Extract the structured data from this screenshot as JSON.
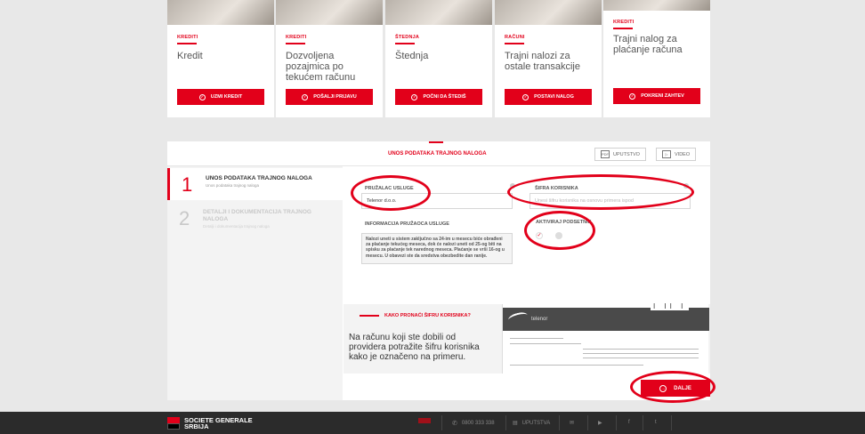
{
  "colors": {
    "accent": "#e2001a",
    "footer": "#2b2b2b"
  },
  "cards": [
    {
      "category": "KREDITI",
      "title": "Kredit",
      "button": "UZMI KREDIT"
    },
    {
      "category": "KREDITI",
      "title": "Dozvoljena pozajmica po tekućem računu",
      "button": "POŠALJI PRIJAVU"
    },
    {
      "category": "ŠTEDNJA",
      "title": "Štednja",
      "button": "POČNI DA ŠTEDIŠ"
    },
    {
      "category": "RAČUNI",
      "title": "Trajni nalozi za ostale transakcije",
      "button": "POSTAVI NALOG"
    },
    {
      "category": "KREDITI",
      "title": "Trajni nalog za plaćanje računa",
      "button": "POKRENI ZAHTEV"
    }
  ],
  "form": {
    "title": "UNOS PODATAKA TRAJNOG NALOGA",
    "manual_label": "UPUTSTVO",
    "video_label": "VIDEO",
    "steps": [
      {
        "num": "1",
        "title": "UNOS PODATAKA TRAJNOG NALOGA",
        "subtitle": "Unos podataka trajnog naloga"
      },
      {
        "num": "2",
        "title": "DETALJI I DOKUMENTACIJA TRAJNOG NALOGA",
        "subtitle": "Detalji i dokumentacija trajnog naloga"
      }
    ],
    "provider_label": "PRUŽALAC USLUGE",
    "provider_value": "Telenor d.o.o.",
    "user_code_label": "ŠIFRA KORISNIKA",
    "user_code_placeholder": "Unesi šifru korisnika na osnovu primera ispod",
    "info_label": "INFORMACIJA PRUŽAOCA USLUGE",
    "info_text": "Nalozi uneti u sistem zaključno sa 24-im u mesecu biće obrađeni za plaćanje tekućeg meseca, dok će nalozi uneti od 25-og biti na spisku za plaćanje tek narednog meseca. Plaćanje se vrši 16-og u mesecu. U obavezi ste da sredstva obezbedite dan ranije.",
    "reminder_label": "AKTIVIRAJ PODSETNIK",
    "help_title": "KAKO PRONAĆI ŠIFRU KORISNIKA?",
    "help_text": "Na računu koji ste dobili od providera potražite šifru korisnika kako je označeno na primeru.",
    "bill_brand": "telenor",
    "bill_ticks": "I II I",
    "next_button": "DALJE"
  },
  "footer": {
    "brand_line1": "SOCIETE GENERALE",
    "brand_line2": "SRBIJA",
    "phone": "0800 333 338",
    "manuals": "UPUTSTVA"
  }
}
